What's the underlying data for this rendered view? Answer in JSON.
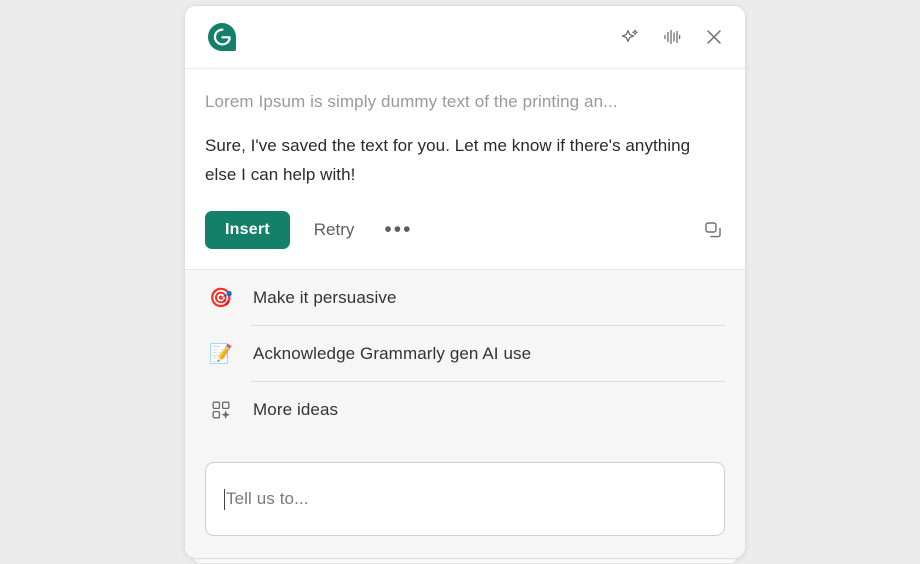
{
  "theme": {
    "page_background": "#ececec",
    "panel_background": "#ffffff",
    "suggestions_background": "#f6f6f6",
    "brand_green": "#15806a",
    "muted_text": "#9a9a9a",
    "body_text": "#2a2a2a"
  },
  "header": {
    "logo_name": "grammarly-logo",
    "logo_letter": "G",
    "actions": [
      {
        "name": "sparkle-icon",
        "label": "AI suggestions"
      },
      {
        "name": "voice-waveform-icon",
        "label": "Voice"
      },
      {
        "name": "close-icon",
        "label": "Close"
      }
    ]
  },
  "conversation": {
    "source_text": "Lorem Ipsum is simply dummy text of the printing an...",
    "reply_text": "Sure, I've saved the text for you. Let me know if there's anything else I can help with!",
    "actions": {
      "insert_label": "Insert",
      "retry_label": "Retry",
      "more_label": "•••",
      "copy_icon_name": "copy-icon"
    }
  },
  "suggestions": {
    "items": [
      {
        "icon": "🎯",
        "icon_name": "target-emoji-icon",
        "label": "Make it persuasive"
      },
      {
        "icon": "📝",
        "icon_name": "memo-emoji-icon",
        "label": "Acknowledge Grammarly gen AI use"
      },
      {
        "icon": "grid-sparkle",
        "icon_name": "grid-sparkle-icon",
        "label": "More ideas"
      }
    ]
  },
  "prompt": {
    "placeholder": "Tell us to...",
    "value": ""
  }
}
